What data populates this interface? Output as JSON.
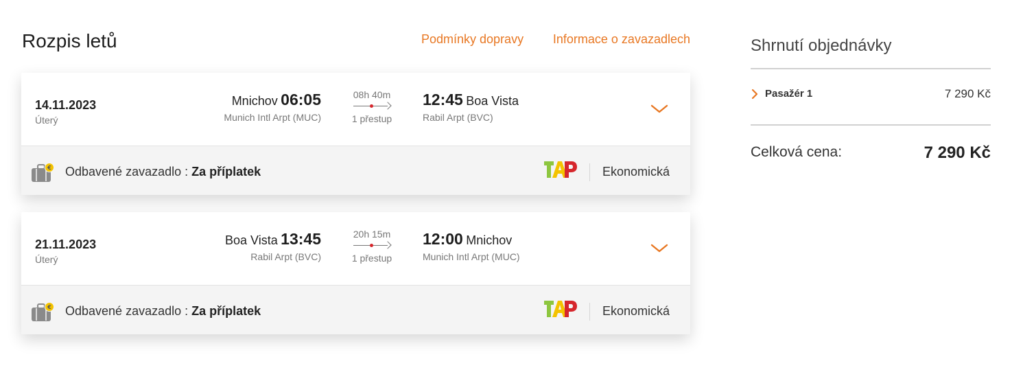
{
  "page": {
    "title": "Rozpis letů",
    "links": [
      "Podmínky dopravy",
      "Informace o zavazadlech"
    ]
  },
  "flights": [
    {
      "date": "14.11.2023",
      "weekday": "Úterý",
      "dep_city": "Mnichov",
      "dep_time": "06:05",
      "dep_airport": "Munich Intl Arpt (MUC)",
      "duration": "08h 40m",
      "stops": "1 přestup",
      "arr_time": "12:45",
      "arr_city": "Boa Vista",
      "arr_airport": "Rabil Arpt (BVC)",
      "baggage_label": "Odbavené zavazadlo :",
      "baggage_value": "Za příplatek",
      "cabin": "Ekonomická",
      "airline_logo_icon": "tap-logo-icon"
    },
    {
      "date": "21.11.2023",
      "weekday": "Úterý",
      "dep_city": "Boa Vista",
      "dep_time": "13:45",
      "dep_airport": "Rabil Arpt (BVC)",
      "duration": "20h 15m",
      "stops": "1 přestup",
      "arr_time": "12:00",
      "arr_city": "Mnichov",
      "arr_airport": "Munich Intl Arpt (MUC)",
      "baggage_label": "Odbavené zavazadlo :",
      "baggage_value": "Za příplatek",
      "cabin": "Ekonomická",
      "airline_logo_icon": "tap-logo-icon"
    }
  ],
  "summary": {
    "title": "Shrnutí objednávky",
    "passenger_label": "Pasažér 1",
    "passenger_price": "7 290 Kč",
    "total_label": "Celková cena:",
    "total_price": "7 290 Kč"
  },
  "colors": {
    "accent": "#e87722",
    "route_dot": "#d6262c",
    "logo_green": "#8dc63f",
    "logo_yellow": "#f4c300",
    "logo_red": "#d6262c"
  }
}
